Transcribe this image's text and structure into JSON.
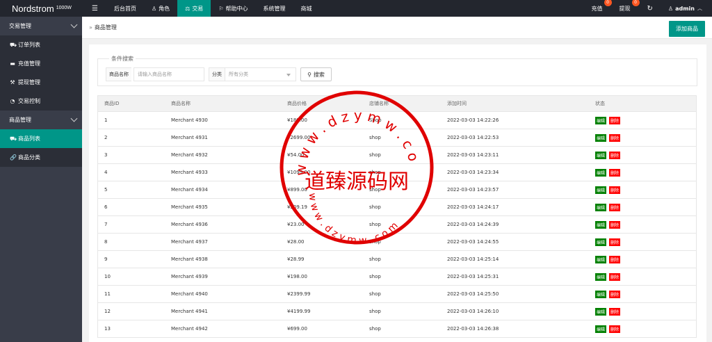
{
  "brand": {
    "name": "Nordstrom",
    "tag": "1000W"
  },
  "topnav": {
    "menu_icon": "hamburger-icon",
    "items": [
      {
        "label": "后台首页",
        "icon": ""
      },
      {
        "label": "角色",
        "icon": "user-icon"
      },
      {
        "label": "交易",
        "icon": "scale-icon",
        "active": true
      },
      {
        "label": "帮助中心",
        "icon": "flag-icon"
      },
      {
        "label": "系统管理",
        "icon": ""
      },
      {
        "label": "商城",
        "icon": ""
      }
    ]
  },
  "topright": {
    "recharge": {
      "label": "充值",
      "badge": "0"
    },
    "withdraw": {
      "label": "提现",
      "badge": "0"
    },
    "refresh_icon": "refresh-icon",
    "user": "admin"
  },
  "sidebar": {
    "groups": [
      {
        "label": "交易管理",
        "items": [
          {
            "label": "订单列表",
            "icon": "cart-icon"
          },
          {
            "label": "充值管理",
            "icon": "monitor-icon"
          },
          {
            "label": "提现管理",
            "icon": "hammer-icon"
          },
          {
            "label": "交易控制",
            "icon": "dashboard-icon"
          }
        ]
      },
      {
        "label": "商品管理",
        "items": [
          {
            "label": "商品列表",
            "icon": "cart-icon",
            "active": true
          },
          {
            "label": "商品分类",
            "icon": "link-icon"
          }
        ]
      }
    ]
  },
  "header": {
    "breadcrumb": "商品管理",
    "add_button": "添加商品"
  },
  "search": {
    "legend": "条件搜索",
    "name_label": "商品名称",
    "name_placeholder": "请输入商品名称",
    "category_label": "分类",
    "category_value": "所有分类",
    "button": "搜索"
  },
  "table": {
    "headers": [
      "商品ID",
      "商品名称",
      "商品价格",
      "店铺名称",
      "添加时间",
      "状态"
    ],
    "edit_label": "编辑",
    "delete_label": "删除",
    "rows": [
      [
        "1",
        "Merchant 4930",
        "¥189.00",
        "Shop",
        "2022-03-03 14:22:26"
      ],
      [
        "2",
        "Merchant 4931",
        "¥2699.00",
        "shop",
        "2022-03-03 14:22:53"
      ],
      [
        "3",
        "Merchant 4932",
        "¥54.00",
        "shop",
        "2022-03-03 14:23:11"
      ],
      [
        "4",
        "Merchant 4933",
        "¥1099.00",
        "shop",
        "2022-03-03 14:23:34"
      ],
      [
        "5",
        "Merchant 4934",
        "¥899.00",
        "shop",
        "2022-03-03 14:23:57"
      ],
      [
        "6",
        "Merchant 4935",
        "¥209.19",
        "shop",
        "2022-03-03 14:24:17"
      ],
      [
        "7",
        "Merchant 4936",
        "¥23.00",
        "shop",
        "2022-03-03 14:24:39"
      ],
      [
        "8",
        "Merchant 4937",
        "¥28.00",
        "shop",
        "2022-03-03 14:24:55"
      ],
      [
        "9",
        "Merchant 4938",
        "¥28.99",
        "shop",
        "2022-03-03 14:25:14"
      ],
      [
        "10",
        "Merchant 4939",
        "¥198.00",
        "shop",
        "2022-03-03 14:25:31"
      ],
      [
        "11",
        "Merchant 4940",
        "¥2399.99",
        "shop",
        "2022-03-03 14:25:50"
      ],
      [
        "12",
        "Merchant 4941",
        "¥4199.99",
        "shop",
        "2022-03-03 14:26:10"
      ],
      [
        "13",
        "Merchant 4942",
        "¥699.00",
        "shop",
        "2022-03-03 14:26:38"
      ]
    ]
  },
  "watermark": {
    "main_text": "道臻源码网",
    "ring_top": "www.dzymw.com",
    "ring_bottom": "www.dzymw.com",
    "color": "#e00000"
  },
  "colors": {
    "topbar": "#23262e",
    "sidebar": "#393d49",
    "accent": "#009688"
  }
}
